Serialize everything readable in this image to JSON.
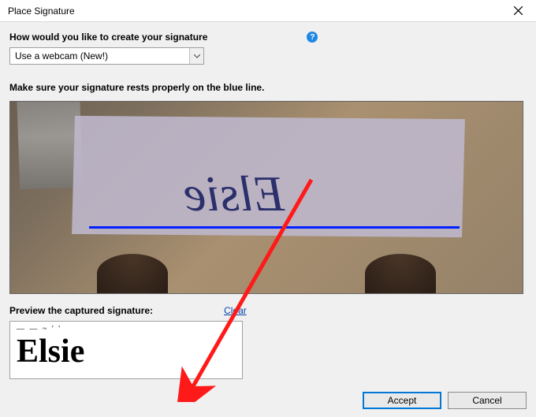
{
  "dialog": {
    "title": "Place Signature"
  },
  "prompt": {
    "question": "How would you like to create your signature",
    "select_value": "Use a webcam (New!)"
  },
  "instruction": "Make sure your signature rests properly on the blue line.",
  "webcam": {
    "signature_raw": "Elsie"
  },
  "preview": {
    "label": "Preview the captured signature:",
    "clear_link": "Clear",
    "artifact": "— —  ~  ' '",
    "signature": "Elsie"
  },
  "buttons": {
    "accept": "Accept",
    "cancel": "Cancel"
  }
}
